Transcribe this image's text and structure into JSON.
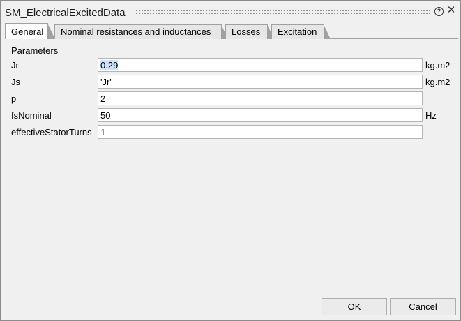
{
  "window": {
    "title": "SM_ElectricalExcitedData",
    "help_symbol": "?",
    "close_symbol": "✕"
  },
  "tabs": [
    {
      "label": "General",
      "active": true
    },
    {
      "label": "Nominal resistances and inductances",
      "active": false
    },
    {
      "label": "Losses",
      "active": false
    },
    {
      "label": "Excitation",
      "active": false
    }
  ],
  "section": {
    "label": "Parameters"
  },
  "params": [
    {
      "label": "Jr",
      "value": "0.29",
      "unit": "kg.m2"
    },
    {
      "label": "Js",
      "value": "'Jr'",
      "unit": "kg.m2"
    },
    {
      "label": "p",
      "value": "2",
      "unit": ""
    },
    {
      "label": "fsNominal",
      "value": "50",
      "unit": "Hz"
    },
    {
      "label": "effectiveStatorTurns",
      "value": "1",
      "unit": ""
    }
  ],
  "buttons": {
    "ok": {
      "mnemonic": "O",
      "rest": "K"
    },
    "cancel": {
      "mnemonic": "C",
      "rest": "ancel"
    }
  },
  "colors": {
    "background": "#f0f0f0",
    "selection": "#cfe3f8"
  }
}
